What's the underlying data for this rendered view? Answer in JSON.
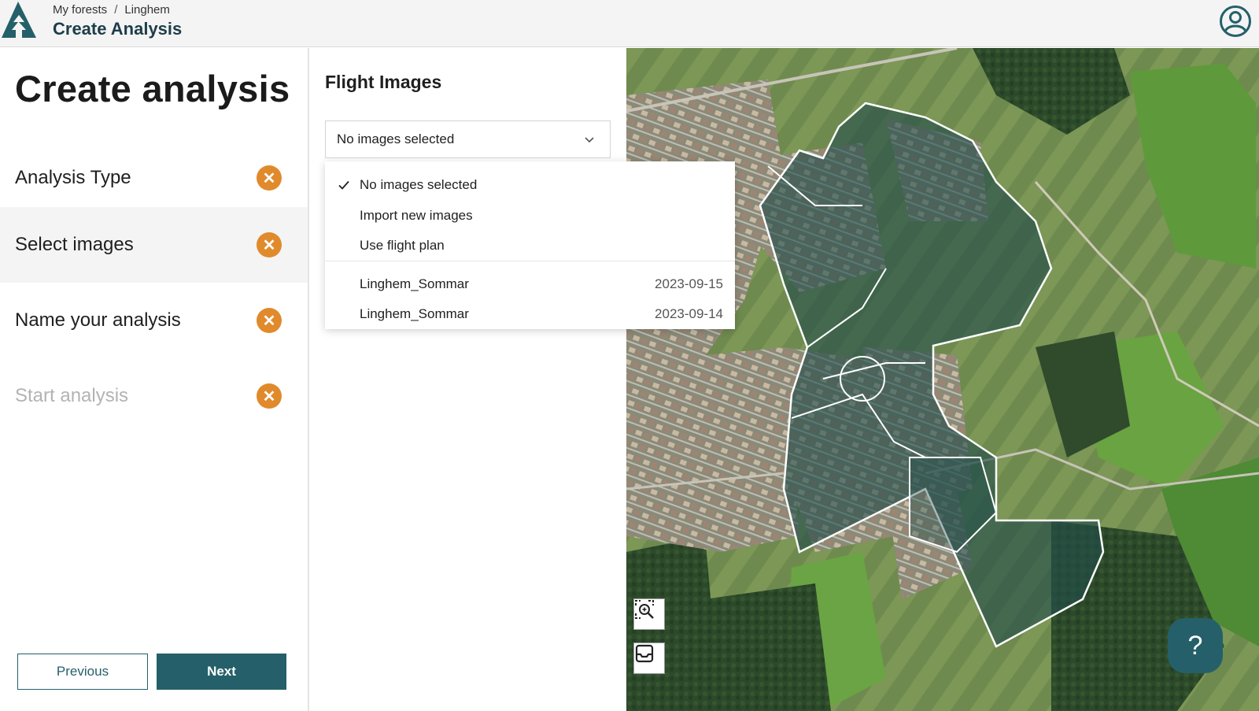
{
  "header": {
    "breadcrumb": [
      "My forests",
      "Linghem"
    ],
    "breadcrumb_separator": "/",
    "title": "Create Analysis"
  },
  "steps_panel": {
    "heading": "Create analysis",
    "steps": [
      {
        "label": "Analysis Type",
        "status_icon": "close-icon",
        "state": "default"
      },
      {
        "label": "Select images",
        "status_icon": "close-icon",
        "state": "active"
      },
      {
        "label": "Name your analysis",
        "status_icon": "close-icon",
        "state": "default"
      },
      {
        "label": "Start analysis",
        "status_icon": "close-icon",
        "state": "disabled"
      }
    ],
    "previous_label": "Previous",
    "next_label": "Next"
  },
  "images_panel": {
    "heading": "Flight Images",
    "select_value": "No images selected",
    "dropdown": {
      "options": [
        {
          "label": "No images selected",
          "checked": true
        },
        {
          "label": "Import new images",
          "checked": false
        },
        {
          "label": "Use flight plan",
          "checked": false
        }
      ],
      "flights": [
        {
          "name": "Linghem_Sommar",
          "date": "2023-09-15"
        },
        {
          "name": "Linghem_Sommar",
          "date": "2023-09-14"
        }
      ]
    }
  },
  "map": {
    "tools": [
      "zoom-to-selection-icon",
      "layers-icon"
    ],
    "help_label": "?"
  },
  "colors": {
    "primary": "#25606a",
    "status_error": "#e08a2c",
    "brand_title": "#1d3d4a"
  }
}
